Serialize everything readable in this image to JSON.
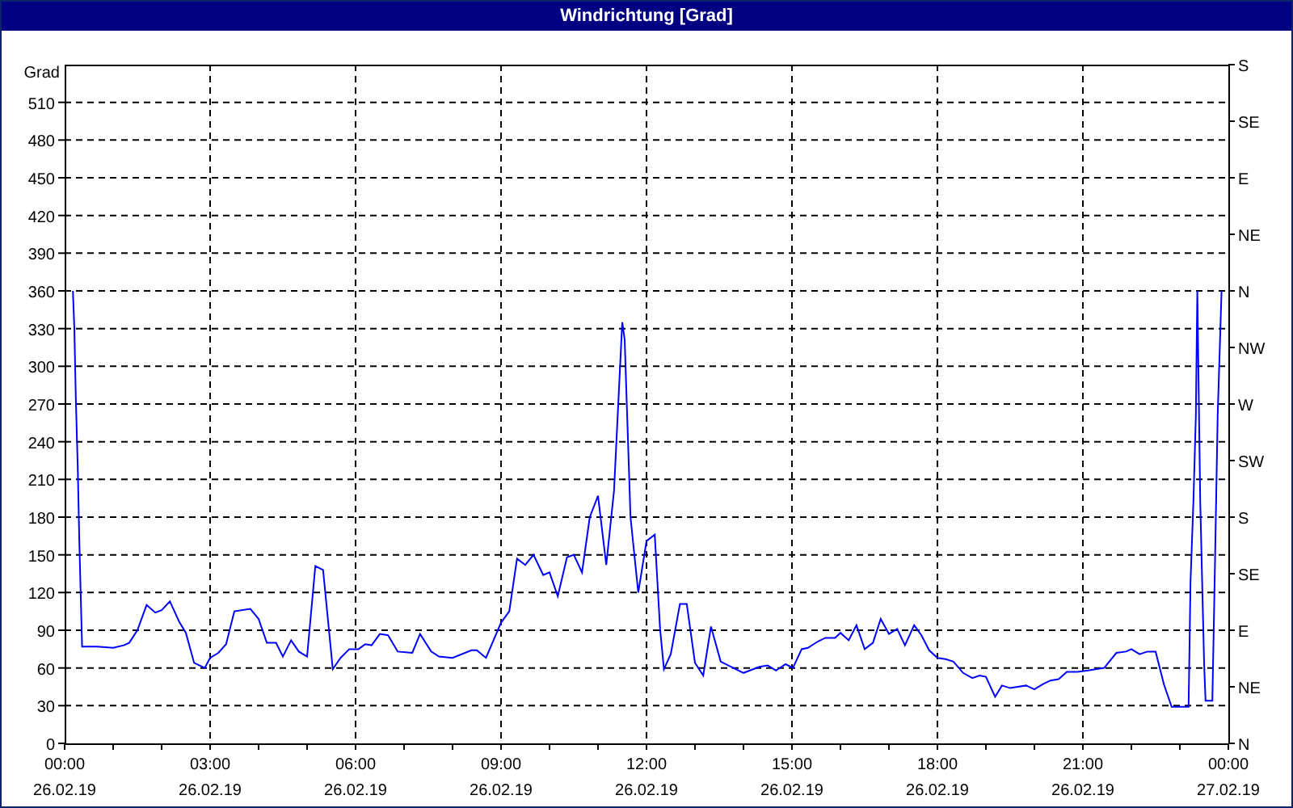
{
  "window": {
    "title": "Windrichtung [Grad]"
  },
  "chart": {
    "chart_data": {
      "type": "line",
      "grid": true,
      "ylabel": "Grad",
      "xlim": [
        0,
        24
      ],
      "ylim": [
        0,
        540
      ],
      "xticks": [
        {
          "value": 0,
          "label": "00:00"
        },
        {
          "value": 3,
          "label": "03:00"
        },
        {
          "value": 6,
          "label": "06:00"
        },
        {
          "value": 9,
          "label": "09:00"
        },
        {
          "value": 12,
          "label": "12:00"
        },
        {
          "value": 15,
          "label": "15:00"
        },
        {
          "value": 18,
          "label": "18:00"
        },
        {
          "value": 21,
          "label": "21:00"
        },
        {
          "value": 24,
          "label": "00:00"
        }
      ],
      "yticks": [
        0,
        30,
        60,
        90,
        120,
        150,
        180,
        210,
        240,
        270,
        300,
        330,
        360,
        390,
        420,
        450,
        480,
        510
      ],
      "x": [
        0.17,
        0.2,
        0.23,
        0.27,
        0.3,
        0.33,
        0.36,
        0.67,
        1.0,
        1.22,
        1.33,
        1.5,
        1.69,
        1.87,
        2.0,
        2.17,
        2.36,
        2.5,
        2.67,
        2.89,
        3.0,
        3.17,
        3.33,
        3.5,
        3.83,
        4.0,
        4.17,
        4.36,
        4.5,
        4.67,
        4.83,
        5.0,
        5.17,
        5.33,
        5.53,
        5.69,
        5.87,
        6.06,
        6.2,
        6.33,
        6.5,
        6.67,
        6.87,
        7.17,
        7.33,
        7.56,
        7.72,
        8.0,
        8.39,
        8.5,
        8.69,
        9.0,
        9.17,
        9.33,
        9.5,
        9.67,
        9.87,
        10.0,
        10.17,
        10.36,
        10.5,
        10.67,
        10.83,
        11.0,
        11.17,
        11.33,
        11.5,
        11.55,
        11.67,
        11.83,
        12.0,
        12.17,
        12.28,
        12.36,
        12.5,
        12.69,
        12.83,
        13.0,
        13.17,
        13.33,
        13.53,
        14.0,
        14.33,
        14.5,
        14.67,
        14.87,
        15.02,
        15.2,
        15.33,
        15.53,
        15.69,
        15.89,
        16.0,
        16.17,
        16.33,
        16.5,
        16.67,
        16.83,
        17.0,
        17.17,
        17.33,
        17.52,
        17.67,
        17.83,
        18.0,
        18.17,
        18.33,
        18.53,
        18.72,
        18.87,
        19.0,
        19.19,
        19.33,
        19.5,
        19.83,
        20.0,
        20.17,
        20.33,
        20.5,
        20.67,
        20.89,
        21.11,
        21.44,
        21.69,
        21.89,
        22.0,
        22.17,
        22.33,
        22.5,
        22.67,
        22.83,
        23.09,
        23.18,
        23.22,
        23.28,
        23.33,
        23.36,
        23.42,
        23.5,
        23.53,
        23.67,
        23.72,
        23.78,
        23.86
      ],
      "series": [
        {
          "color": "#0000ff",
          "values": [
            360,
            330,
            275,
            220,
            165,
            120,
            77,
            77,
            76,
            78,
            80,
            90,
            110,
            104,
            106,
            113,
            97,
            88,
            64,
            60,
            68,
            72,
            79,
            105,
            107,
            99,
            80,
            80,
            69,
            82,
            73,
            69,
            141,
            138,
            59,
            68,
            75,
            75,
            79,
            78,
            87,
            86,
            73,
            72,
            87,
            73,
            69,
            68,
            74,
            74,
            68,
            96,
            105,
            147,
            142,
            150,
            134,
            136,
            117,
            148,
            150,
            136,
            180,
            197,
            142,
            201,
            335,
            321,
            180,
            120,
            161,
            166,
            91,
            59,
            71,
            111,
            111,
            64,
            54,
            93,
            65,
            56,
            61,
            62,
            58,
            63,
            60,
            75,
            76,
            81,
            84,
            84,
            88,
            82,
            94,
            75,
            80,
            99,
            87,
            91,
            78,
            94,
            86,
            74,
            68,
            67,
            65,
            56,
            52,
            54,
            53,
            37,
            46,
            44,
            46,
            43,
            47,
            50,
            51,
            57,
            57,
            58,
            60,
            72,
            73,
            75,
            71,
            73,
            73,
            47,
            29,
            29,
            29,
            129,
            193,
            261,
            360,
            193,
            64,
            34,
            34,
            134,
            261,
            360
          ]
        }
      ]
    },
    "xtick_dates": [
      "26.02.19",
      "26.02.19",
      "26.02.19",
      "26.02.19",
      "26.02.19",
      "26.02.19",
      "26.02.19",
      "26.02.19",
      "27.02.19"
    ],
    "secondary_yticks": [
      "S",
      "SE",
      "E",
      "NE",
      "N",
      "NW",
      "W",
      "SW",
      "S",
      "SE",
      "E",
      "NE",
      "N"
    ]
  }
}
